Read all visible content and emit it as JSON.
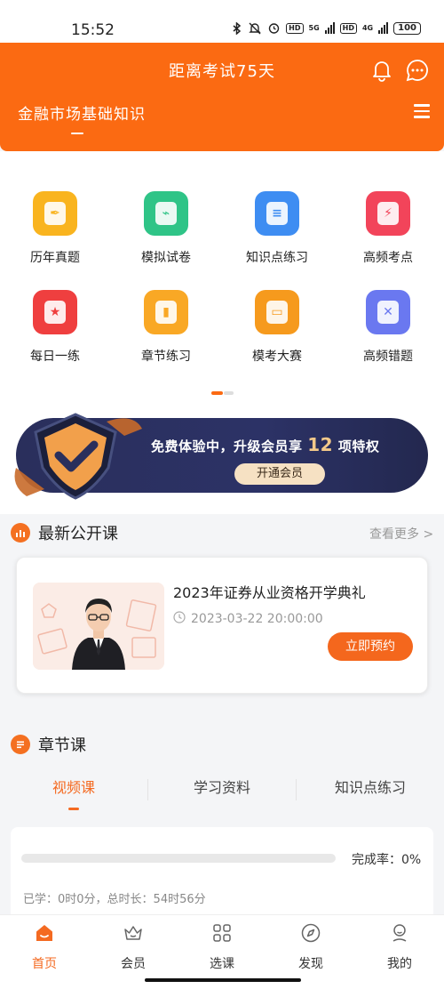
{
  "status_bar": {
    "time": "15:52",
    "battery": "100",
    "net1": "5G",
    "net2": "4G",
    "hd": "HD"
  },
  "header": {
    "countdown": "距离考试75天",
    "subject": "金融市场基础知识",
    "bg_color": "#fb6a12"
  },
  "grid": [
    {
      "label": "历年真题",
      "icon": "pen-nib-icon",
      "color": "#f9b41f",
      "glyph": "✒"
    },
    {
      "label": "模拟试卷",
      "icon": "chart-paper-icon",
      "color": "#2fc487",
      "glyph": "⌁"
    },
    {
      "label": "知识点练习",
      "icon": "note-icon",
      "color": "#3e8df2",
      "glyph": "≡"
    },
    {
      "label": "高频考点",
      "icon": "lightning-icon",
      "color": "#f2445a",
      "glyph": "⚡"
    },
    {
      "label": "每日一练",
      "icon": "star-bookmark-icon",
      "color": "#ef3f3f",
      "glyph": "★"
    },
    {
      "label": "章节练习",
      "icon": "book-icon",
      "color": "#f9a825",
      "glyph": "▮"
    },
    {
      "label": "模考大赛",
      "icon": "monitor-icon",
      "color": "#f69a1d",
      "glyph": "▭"
    },
    {
      "label": "高频错题",
      "icon": "error-box-icon",
      "color": "#6a78f0",
      "glyph": "✕"
    }
  ],
  "banner": {
    "text_prefix": "免费体验中，升级会员享",
    "text_number": "12",
    "text_suffix": "项特权",
    "button": "开通会员"
  },
  "latest_courses": {
    "title": "最新公开课",
    "see_more": "查看更多 >",
    "course": {
      "title": "2023年证券从业资格开学典礼",
      "datetime": "2023-03-22 20:00:00",
      "button": "立即预约"
    }
  },
  "chapter": {
    "title": "章节课",
    "tabs": [
      "视频课",
      "学习资料",
      "知识点练习"
    ],
    "active_tab": 0,
    "completion_label": "完成率：0%",
    "completion": 0,
    "study_info": "已学：0时0分，总时长：54时56分"
  },
  "bottom_nav": [
    {
      "label": "首页",
      "icon": "home-icon",
      "active": true
    },
    {
      "label": "会员",
      "icon": "crown-icon",
      "active": false
    },
    {
      "label": "选课",
      "icon": "grid-icon",
      "active": false
    },
    {
      "label": "发现",
      "icon": "compass-icon",
      "active": false
    },
    {
      "label": "我的",
      "icon": "profile-icon",
      "active": false
    }
  ]
}
